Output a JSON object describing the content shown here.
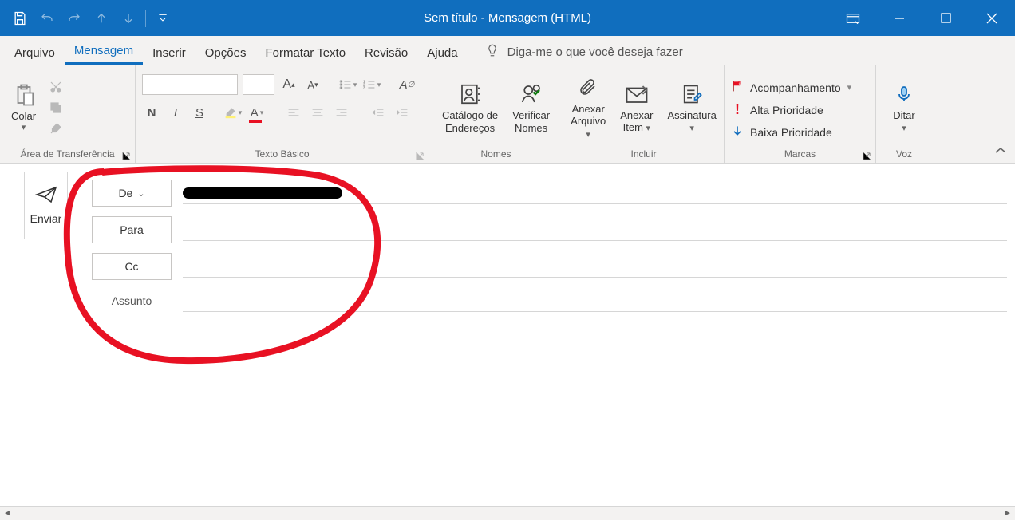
{
  "title": "Sem título  -  Mensagem (HTML)",
  "tabs": {
    "arquivo": "Arquivo",
    "mensagem": "Mensagem",
    "inserir": "Inserir",
    "opcoes": "Opções",
    "formatar": "Formatar Texto",
    "revisao": "Revisão",
    "ajuda": "Ajuda",
    "tellme": "Diga-me o que você deseja fazer"
  },
  "ribbon": {
    "clipboard": {
      "paste": "Colar",
      "group": "Área de Transferência"
    },
    "basictext": {
      "group": "Texto Básico",
      "bold": "N",
      "italic": "I",
      "underline": "S"
    },
    "names": {
      "addressbook_l1": "Catálogo de",
      "addressbook_l2": "Endereços",
      "checknames_l1": "Verificar",
      "checknames_l2": "Nomes",
      "group": "Nomes"
    },
    "include": {
      "attachfile_l1": "Anexar",
      "attachfile_l2": "Arquivo",
      "attachitem_l1": "Anexar",
      "attachitem_l2": "Item",
      "signature_l1": "Assinatura",
      "group": "Incluir"
    },
    "tags": {
      "followup": "Acompanhamento",
      "high": "Alta Prioridade",
      "low": "Baixa Prioridade",
      "group": "Marcas"
    },
    "voice": {
      "dictate": "Ditar",
      "group": "Voz"
    }
  },
  "compose": {
    "send": "Enviar",
    "from": "De",
    "to": "Para",
    "cc": "Cc",
    "subject": "Assunto"
  }
}
